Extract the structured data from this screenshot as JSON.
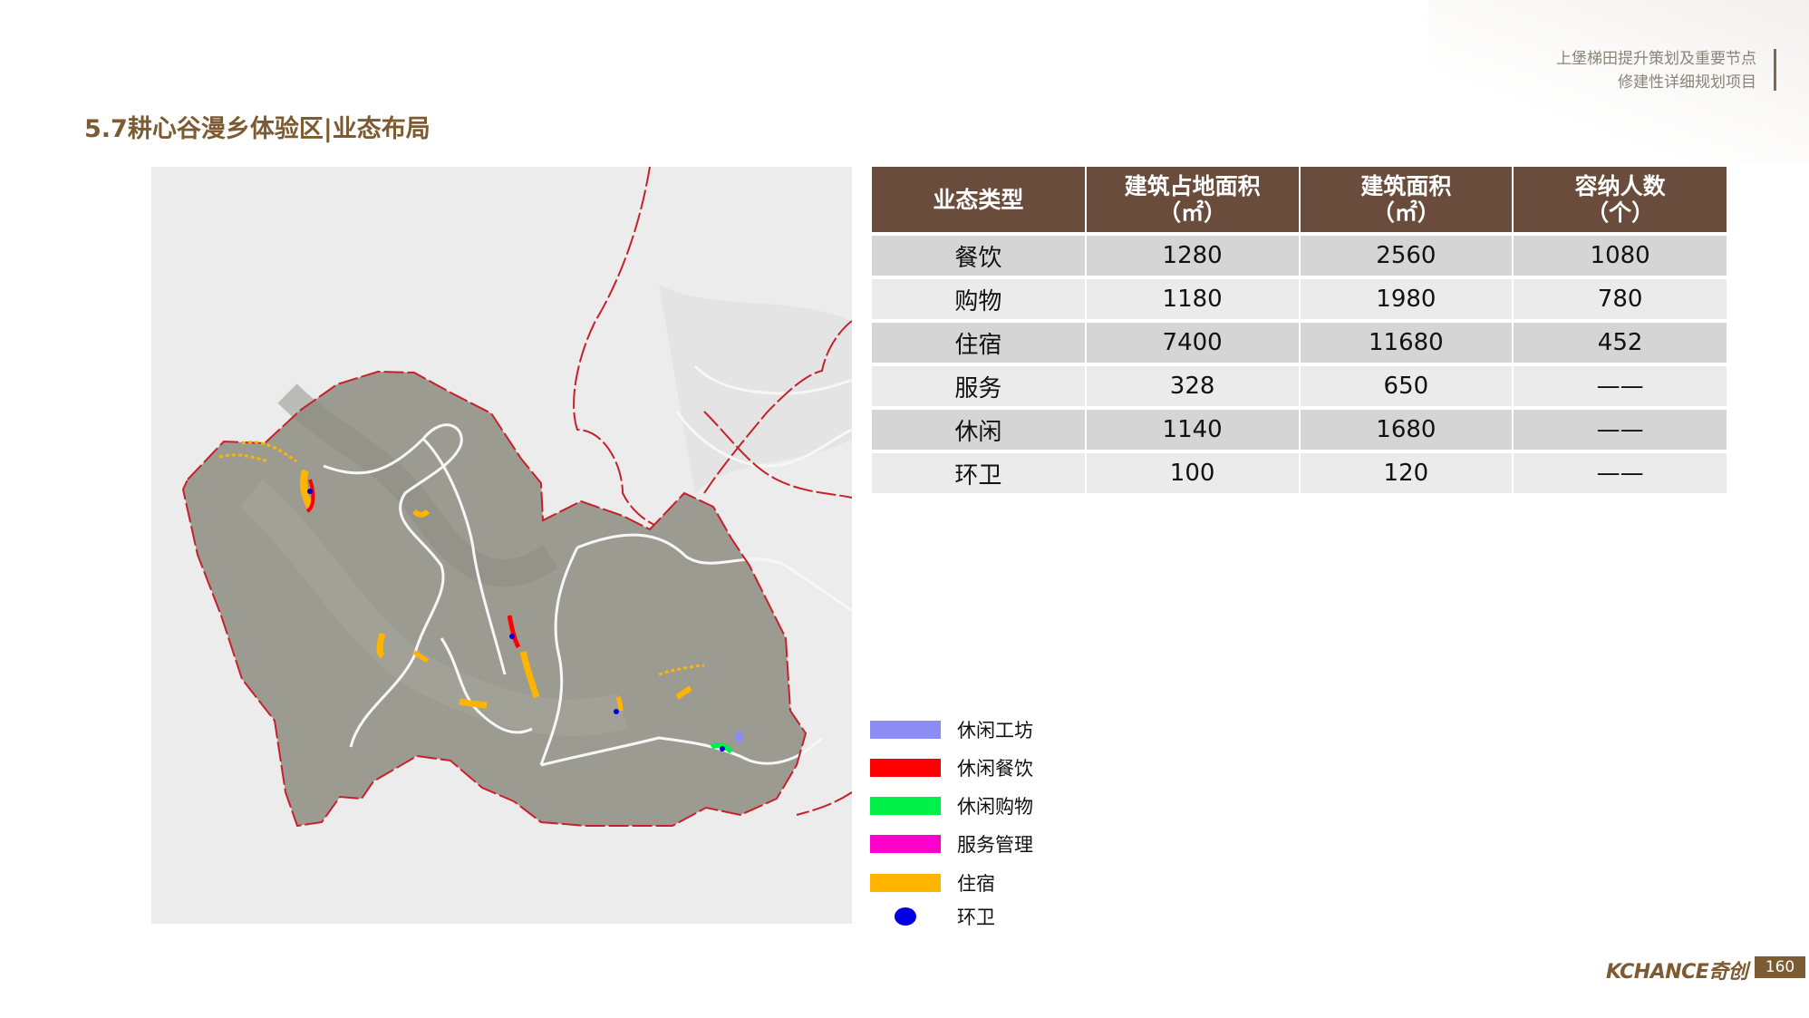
{
  "header": {
    "project_line1": "上堡梯田提升策划及重要节点",
    "project_line2": "修建性详细规划项目",
    "page_title": "5.7耕心谷漫乡体验区|业态布局"
  },
  "table": {
    "headers": [
      {
        "main": "业态类型",
        "sub": ""
      },
      {
        "main": "建筑占地面积",
        "sub": "（㎡）"
      },
      {
        "main": "建筑面积",
        "sub": "（㎡）"
      },
      {
        "main": "容纳人数",
        "sub": "（个）"
      }
    ],
    "rows": [
      [
        "餐饮",
        "1280",
        "2560",
        "1080"
      ],
      [
        "购物",
        "1180",
        "1980",
        "780"
      ],
      [
        "住宿",
        "7400",
        "11680",
        "452"
      ],
      [
        "服务",
        "328",
        "650",
        "——"
      ],
      [
        "休闲",
        "1140",
        "1680",
        "——"
      ],
      [
        "环卫",
        "100",
        "120",
        "——"
      ]
    ]
  },
  "legend": [
    {
      "label": "休闲工坊",
      "color": "#8b8df5",
      "shape": "bar"
    },
    {
      "label": "休闲餐饮",
      "color": "#ff0000",
      "shape": "bar"
    },
    {
      "label": "休闲购物",
      "color": "#00f04a",
      "shape": "bar"
    },
    {
      "label": "服务管理",
      "color": "#ff00cc",
      "shape": "bar"
    },
    {
      "label": "住宿",
      "color": "#ffb400",
      "shape": "bar"
    },
    {
      "label": "环卫",
      "color": "#0000e0",
      "shape": "dot"
    }
  ],
  "footer": {
    "logo": "KCHANCE奇创",
    "page_number": "160"
  },
  "colors": {
    "accent_brown": "#7d5b32",
    "header_brown": "#6a4c3c",
    "boundary_red": "#c8202a"
  }
}
